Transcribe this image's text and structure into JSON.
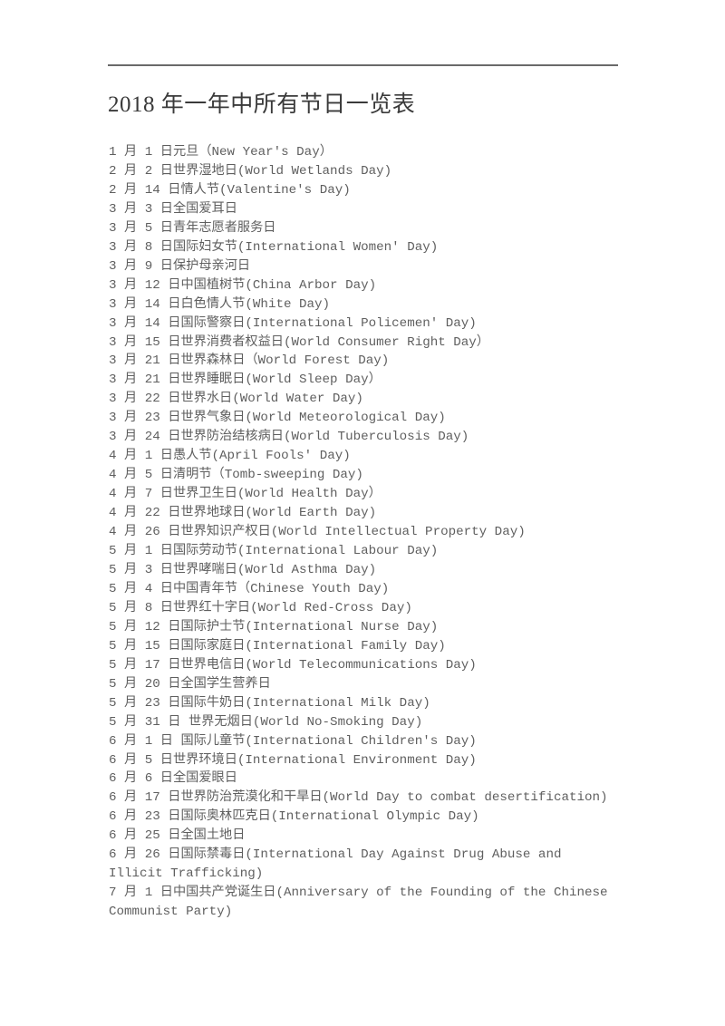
{
  "document": {
    "title": "2018 年一年中所有节日一览表",
    "rule_color": "#696969",
    "text_color": "#5f5f5f",
    "title_color": "#3a3a3a",
    "background_color": "#ffffff"
  },
  "holidays": [
    "1 月 1 日元旦（New Year's Day）",
    "2 月 2 日世界湿地日(World Wetlands Day)",
    "2 月 14 日情人节(Valentine's Day)",
    "3 月 3 日全国爱耳日",
    "3 月 5 日青年志愿者服务日",
    "3 月 8 日国际妇女节(International Women' Day)",
    "3 月 9 日保护母亲河日",
    "3 月 12 日中国植树节(China Arbor Day)",
    "3 月 14 日白色情人节(White Day)",
    "3 月 14 日国际警察日(International Policemen' Day)",
    "3 月 15 日世界消费者权益日(World Consumer Right Day）",
    "3 月 21 日世界森林日（World Forest Day)",
    "3 月 21 日世界睡眠日(World Sleep Day）",
    "3 月 22 日世界水日(World Water Day)",
    "3 月 23 日世界气象日(World Meteorological Day)",
    "3 月 24 日世界防治结核病日(World Tuberculosis Day)",
    "4 月 1 日愚人节(April Fools' Day)",
    "4 月 5 日清明节（Tomb-sweeping Day)",
    "4 月 7 日世界卫生日(World Health Day）",
    "4 月 22 日世界地球日(World Earth Day)",
    "4 月 26 日世界知识产权日(World Intellectual Property Day)",
    "5 月 1 日国际劳动节(International Labour Day)",
    "5 月 3 日世界哮喘日(World Asthma Day)",
    "5 月 4 日中国青年节（Chinese Youth Day)",
    "5 月 8 日世界红十字日(World Red-Cross Day)",
    "5 月 12 日国际护士节(International Nurse Day)",
    "5 月 15 日国际家庭日(International Family Day)",
    "5 月 17 日世界电信日(World Telecommunications Day)",
    "5 月 20 日全国学生营养日",
    "5 月 23 日国际牛奶日(International Milk Day)",
    "5 月 31 日 世界无烟日(World No-Smoking Day)",
    "6 月 1 日 国际儿童节(International Children's Day)",
    "6 月 5 日世界环境日(International Environment Day)",
    "6 月 6 日全国爱眼日",
    "6 月 17 日世界防治荒漠化和干旱日(World Day to combat desertification)",
    "6 月 23 日国际奥林匹克日(International Olympic Day)",
    "6 月 25 日全国土地日",
    "6 月 26 日国际禁毒日(International Day Against Drug Abuse and Illicit Trafficking)",
    "7 月 1 日中国共产党诞生日(Anniversary of the Founding of the Chinese Communist Party)"
  ]
}
